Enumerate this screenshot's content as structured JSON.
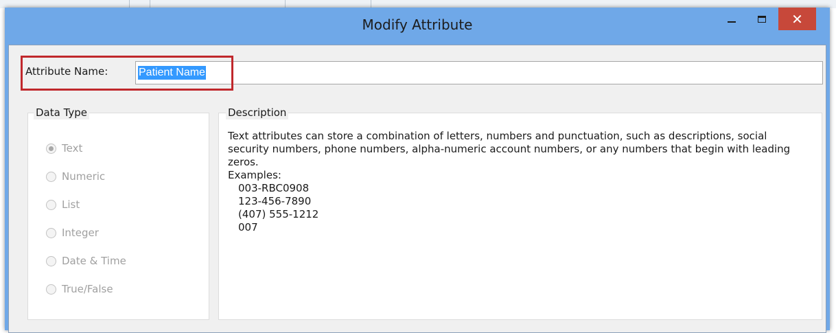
{
  "dialog": {
    "title": "Modify Attribute",
    "close_glyph": "✕"
  },
  "attribute_name": {
    "label": "Attribute Name:",
    "value": "Patient Name"
  },
  "data_type": {
    "legend": "Data Type",
    "options": [
      {
        "label": "Text",
        "selected": true
      },
      {
        "label": "Numeric",
        "selected": false
      },
      {
        "label": "List",
        "selected": false
      },
      {
        "label": "Integer",
        "selected": false
      },
      {
        "label": "Date & Time",
        "selected": false
      },
      {
        "label": "True/False",
        "selected": false
      }
    ]
  },
  "description": {
    "legend": "Description",
    "text": "Text attributes can store a combination of letters, numbers and punctuation, such as descriptions, social security numbers, phone numbers, alpha-numeric account numbers, or any numbers that begin with leading zeros.",
    "examples_label": "Examples:",
    "examples": [
      "003-RBC0908",
      "123-456-7890",
      "(407) 555-1212",
      "007"
    ]
  },
  "colors": {
    "titlebar": "#6fa8e8",
    "close_button": "#c7483a",
    "highlight_box": "#c0282c",
    "selection": "#3399ff"
  }
}
